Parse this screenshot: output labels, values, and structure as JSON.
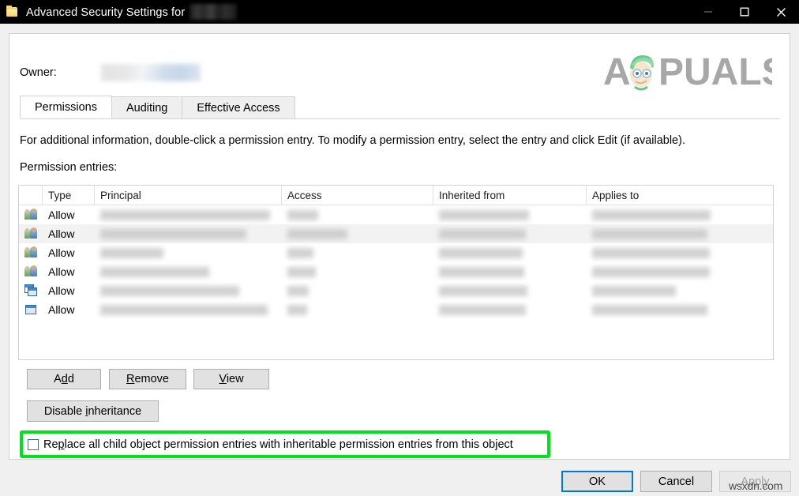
{
  "window": {
    "title_prefix": "Advanced Security Settings for",
    "title_redacted": true,
    "icon": "folder-icon",
    "controls": {
      "minimize": "minimize-icon",
      "maximize": "maximize-icon",
      "close": "close-icon"
    }
  },
  "owner": {
    "label": "Owner:",
    "value_redacted": true
  },
  "branding": {
    "logo_text": "APPUALS",
    "logo_color": "#9b9b9b",
    "mascot_hair_color": "#54c27a"
  },
  "tabs": [
    {
      "label": "Permissions",
      "active": true
    },
    {
      "label": "Auditing",
      "active": false
    },
    {
      "label": "Effective Access",
      "active": false
    }
  ],
  "main": {
    "info_text": "For additional information, double-click a permission entry. To modify a permission entry, select the entry and click Edit (if available).",
    "entries_label": "Permission entries:"
  },
  "table": {
    "columns": [
      "",
      "Type",
      "Principal",
      "Access",
      "Inherited from",
      "Applies to"
    ],
    "rows": [
      {
        "icon": "users-icon",
        "type": "Allow",
        "selected": false,
        "principal_w": 215,
        "access_w": 39,
        "inherited_w": 114,
        "applies_w": 150
      },
      {
        "icon": "users-icon",
        "type": "Allow",
        "selected": true,
        "principal_w": 185,
        "access_w": 76,
        "inherited_w": 110,
        "applies_w": 146
      },
      {
        "icon": "users-icon",
        "type": "Allow",
        "selected": false,
        "principal_w": 80,
        "access_w": 33,
        "inherited_w": 106,
        "applies_w": 149
      },
      {
        "icon": "users-icon",
        "type": "Allow",
        "selected": false,
        "principal_w": 138,
        "access_w": 36,
        "inherited_w": 108,
        "applies_w": 149
      },
      {
        "icon": "window-stack-icon",
        "type": "Allow",
        "selected": false,
        "principal_w": 176,
        "access_w": 27,
        "inherited_w": 112,
        "applies_w": 106
      },
      {
        "icon": "window-icon",
        "type": "Allow",
        "selected": false,
        "principal_w": 212,
        "access_w": 25,
        "inherited_w": 110,
        "applies_w": 146
      }
    ]
  },
  "buttons": {
    "add": {
      "pre": "A",
      "mnemonic": "d",
      "post": "d"
    },
    "remove": {
      "pre": "",
      "mnemonic": "R",
      "post": "emove"
    },
    "view": {
      "pre": "",
      "mnemonic": "V",
      "post": "iew"
    },
    "disable_inheritance": {
      "pre": "Disable ",
      "mnemonic": "i",
      "post": "nheritance"
    }
  },
  "replace_option": {
    "pre": "Re",
    "mnemonic": "p",
    "post": "lace all child object permission entries with inheritable permission entries from this object",
    "checked": false,
    "highlight_color": "#00e21a"
  },
  "footer": {
    "ok": "OK",
    "cancel": "Cancel",
    "apply": "Apply",
    "apply_enabled": false,
    "default_button": "OK"
  },
  "watermark": "wsxdn.com"
}
